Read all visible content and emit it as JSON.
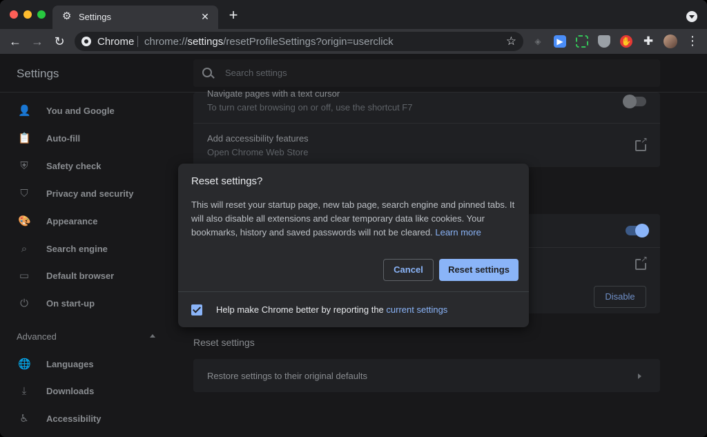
{
  "browser": {
    "tab_title": "Settings",
    "tab_close": "✕",
    "new_tab": "+",
    "omnibox_label": "Chrome",
    "url_prefix": "chrome://",
    "url_host": "settings",
    "url_path": "/resetProfileSettings?origin=userclick"
  },
  "settings": {
    "title": "Settings",
    "search_placeholder": "Search settings"
  },
  "sidebar": {
    "items": [
      {
        "label": "You and Google",
        "icon": "person-icon"
      },
      {
        "label": "Auto-fill",
        "icon": "clipboard-icon"
      },
      {
        "label": "Safety check",
        "icon": "shield-check-icon"
      },
      {
        "label": "Privacy and security",
        "icon": "shield-icon"
      },
      {
        "label": "Appearance",
        "icon": "palette-icon"
      },
      {
        "label": "Search engine",
        "icon": "search-icon"
      },
      {
        "label": "Default browser",
        "icon": "browser-icon"
      },
      {
        "label": "On start-up",
        "icon": "power-icon"
      }
    ],
    "advanced_label": "Advanced",
    "advanced_items": [
      {
        "label": "Languages",
        "icon": "globe-icon"
      },
      {
        "label": "Downloads",
        "icon": "download-icon"
      },
      {
        "label": "Accessibility",
        "icon": "accessibility-icon"
      }
    ]
  },
  "main": {
    "caret_title": "Navigate pages with a text cursor",
    "caret_sub": "To turn caret browsing on or off, use the shortcut F7",
    "a11y_title": "Add accessibility features",
    "a11y_sub": "Open Chrome Web Store",
    "disable_label": "Disable",
    "reset_section_title": "Reset settings",
    "restore_label": "Restore settings to their original defaults"
  },
  "dialog": {
    "title": "Reset settings?",
    "body": "This will reset your startup page, new tab page, search engine and pinned tabs. It will also disable all extensions and clear temporary data like cookies. Your bookmarks, history and saved passwords will not be cleared.",
    "learn_more": "Learn more",
    "cancel_label": "Cancel",
    "reset_label": "Reset settings",
    "checkbox_label": "Help make Chrome better by reporting the",
    "checkbox_link": "current settings",
    "checkbox_checked": true
  },
  "colors": {
    "accent": "#8ab4f8",
    "toggle_on": "#8ab4f8"
  }
}
